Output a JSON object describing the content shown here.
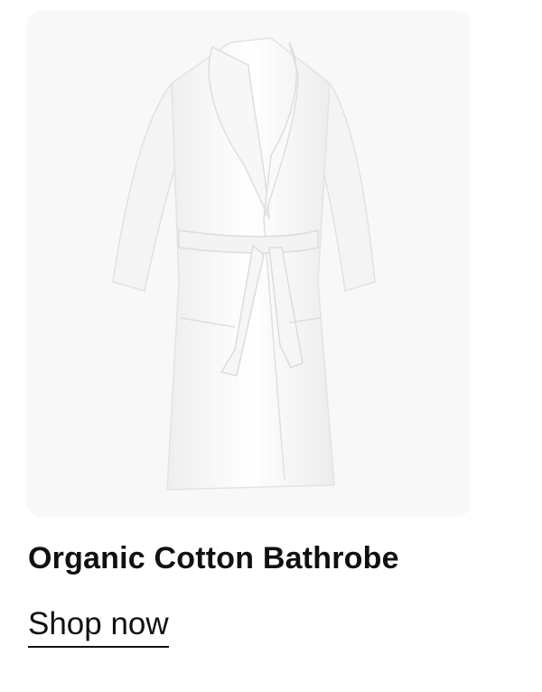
{
  "product": {
    "image_alt": "White organic cotton bathrobe",
    "image_bg_color": "#f8f8f8",
    "title": "Organic Cotton Bathrobe",
    "link_label": "Shop now"
  }
}
